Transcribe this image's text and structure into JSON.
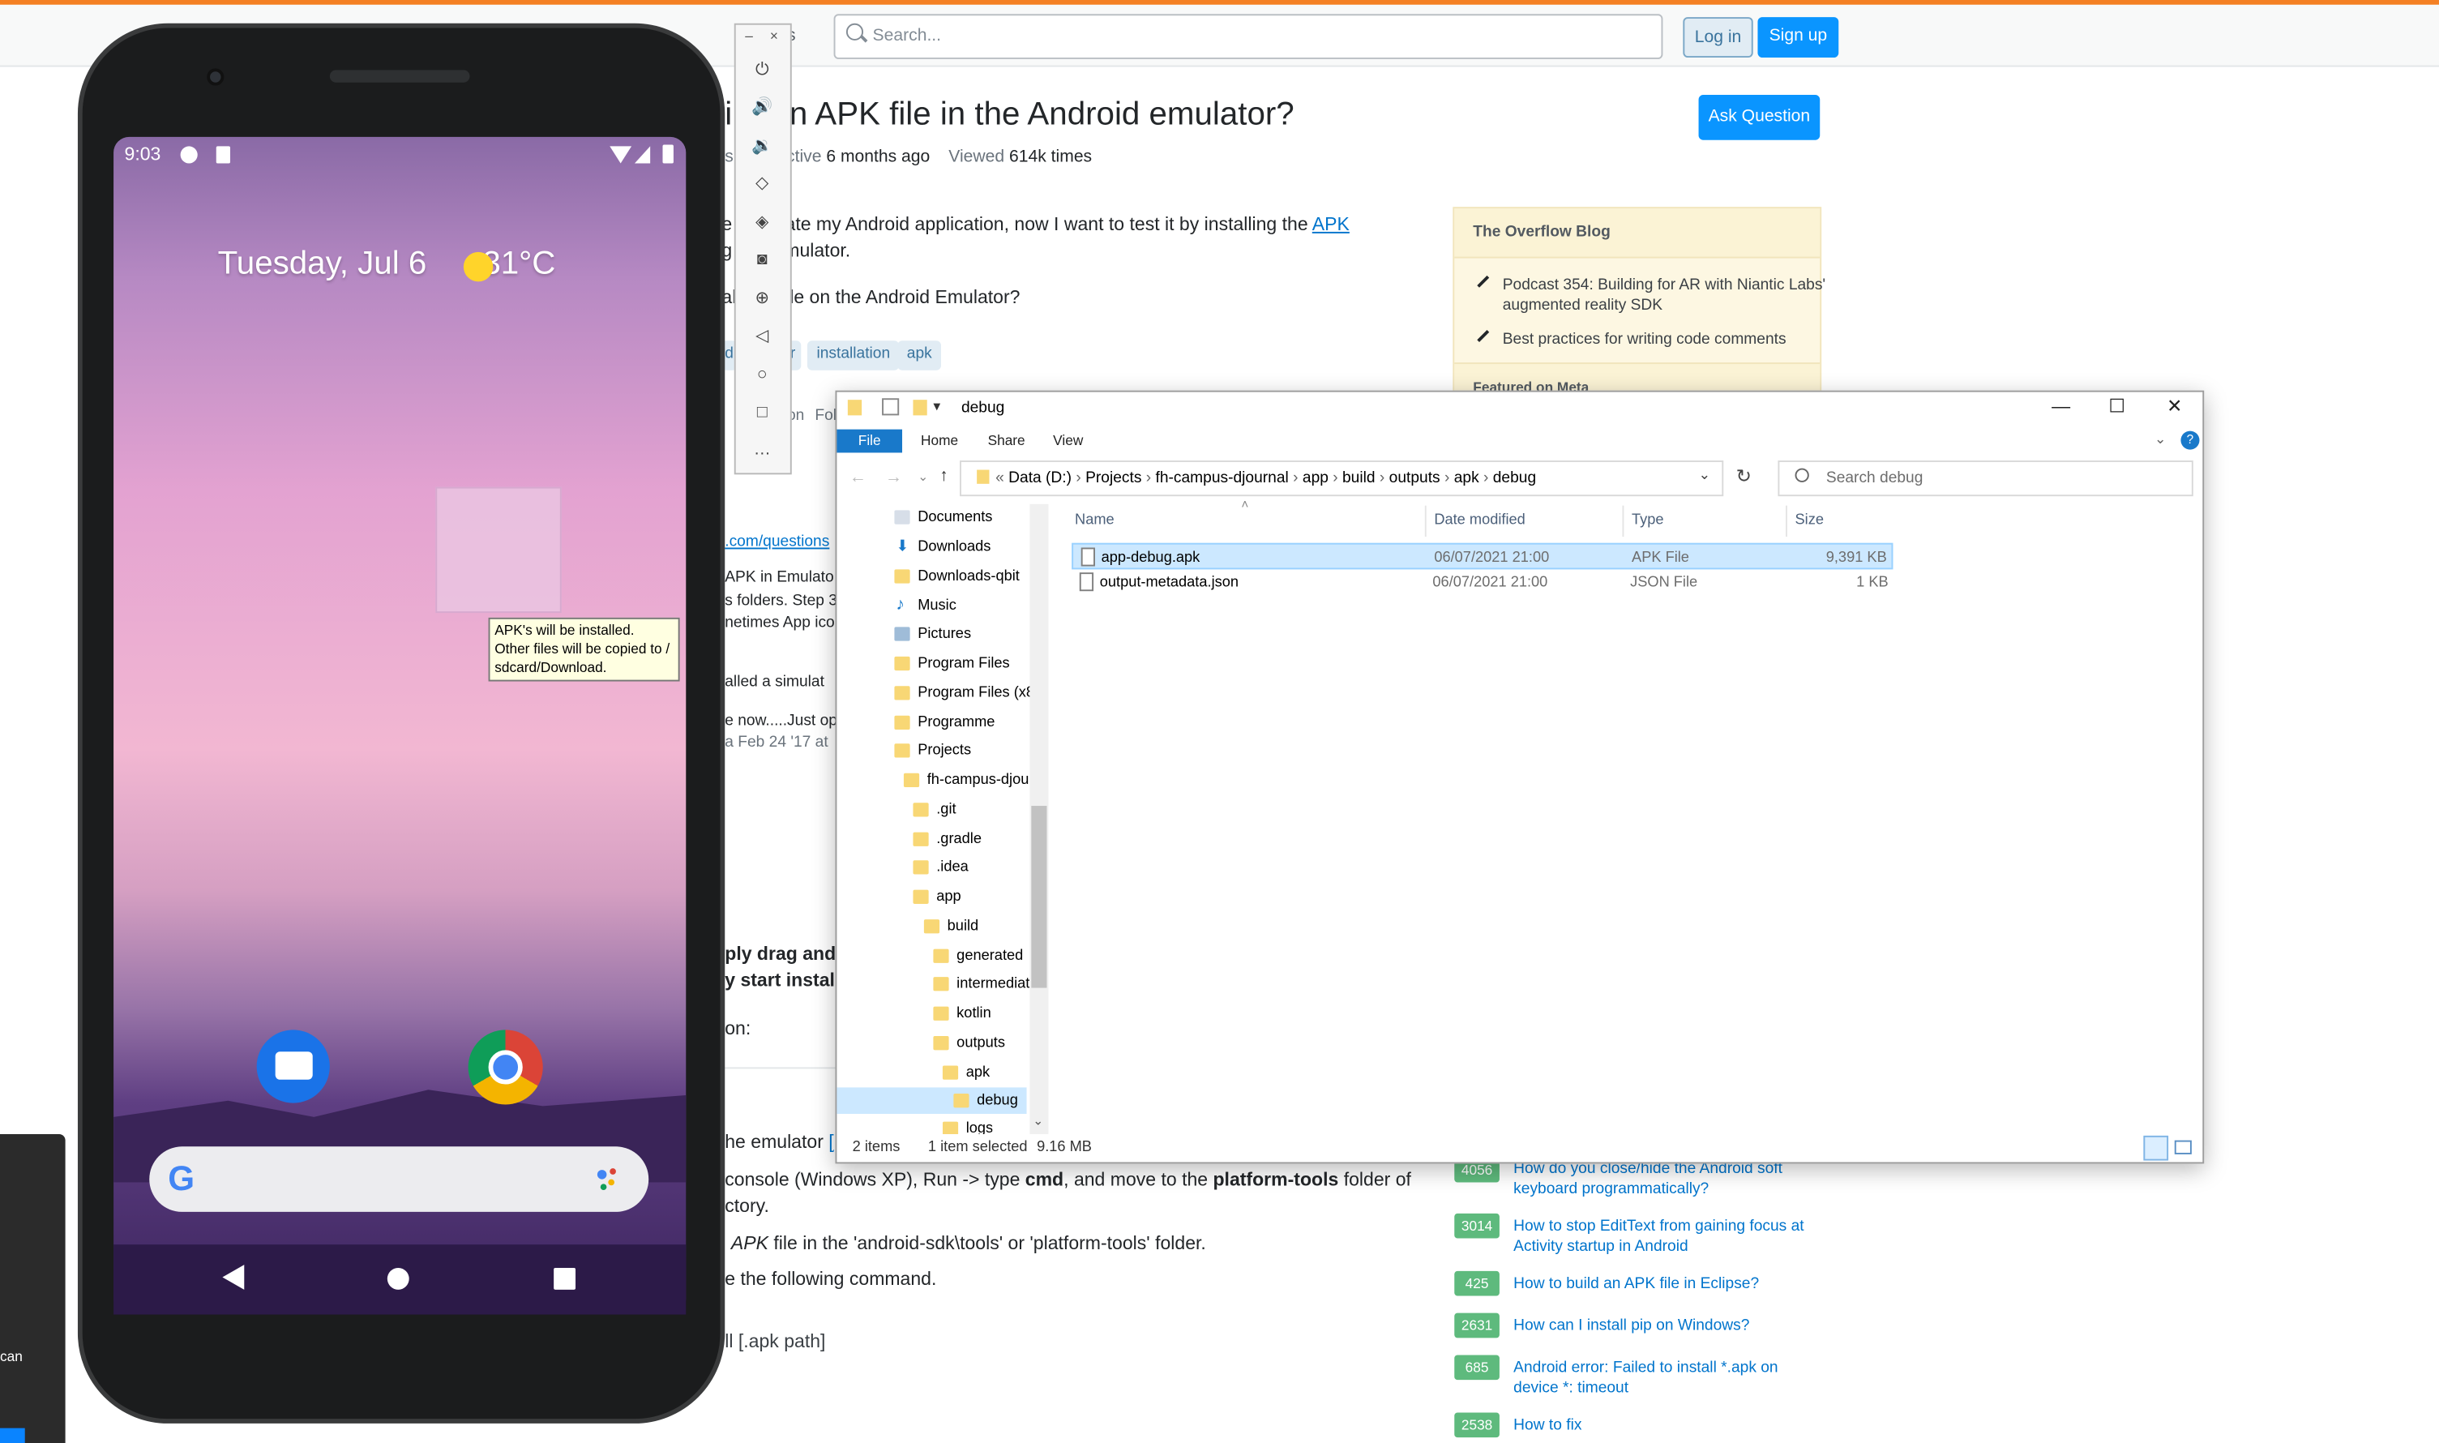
{
  "stackoverflow": {
    "search_placeholder": "Search...",
    "login": "Log in",
    "signup": "Sign up",
    "nav_fragment": "s",
    "title": "ll an APK file in the Android emulator?",
    "title_prefix": "i",
    "ask_question": "Ask Question",
    "meta_asked_fragment": "s",
    "meta_active_label": "ctive",
    "meta_active_value": "6 months ago",
    "meta_viewed_label": "Viewed",
    "meta_viewed_value": "614k times",
    "body_line1": "fuscate my Android application, now I want to test it by installing the ",
    "body_line1_prefix": "e",
    "body_link_apk": "APK",
    "body_line2_prefix": "g",
    "body_line2": "he emulator.",
    "body_line3_prefix": "al",
    "body_line3": "K file on the Android Emulator?",
    "tags": [
      "installation",
      "apk"
    ],
    "tag_fragments": [
      "d",
      "r"
    ],
    "follow_fragments": [
      "on",
      "Fol"
    ],
    "link_fragment": ".com/questions",
    "frag_lines": [
      "APK in Emulato",
      "s folders. Step 3",
      "netimes App ico",
      "alled a simulat",
      "e now.....Just op",
      "a Feb 24 '17 at"
    ],
    "bold_lines": [
      "ply drag and",
      "y start install"
    ],
    "on_line": "on:",
    "answer_emulator": "he emulator",
    "answer_emulator_link": "[",
    "answer_line2_a": "console (Windows XP), Run -> type ",
    "answer_line2_cmd": "cmd",
    "answer_line2_b": ", and move to the ",
    "answer_line2_pt": "platform-tools",
    "answer_line2_c": " folder of",
    "answer_line3": "ctory.",
    "answer_line4_apk": "APK",
    "answer_line4": " file in the 'android-sdk\\tools' or 'platform-tools' folder.",
    "answer_line5": "e the following command.",
    "answer_line6": "ll [.apk path]",
    "left_panel_text": "can"
  },
  "blog": {
    "title": "The Overflow Blog",
    "items": [
      "Podcast 354: Building for AR with Niantic Labs' augmented reality SDK",
      "Best practices for writing code comments"
    ],
    "featured_fragment": "Featured on Meta"
  },
  "related": [
    {
      "count": "4056",
      "text": "How do you close/hide the Android soft keyboard programmatically?"
    },
    {
      "count": "3014",
      "text": "How to stop EditText from gaining focus at Activity startup in Android"
    },
    {
      "count": "425",
      "text": "How to build an APK file in Eclipse?"
    },
    {
      "count": "2631",
      "text": "How can I install pip on Windows?"
    },
    {
      "count": "685",
      "text": "Android error: Failed to install *.apk on device *: timeout"
    },
    {
      "count": "2538",
      "text": "How to fix"
    }
  ],
  "phone": {
    "time": "9:03",
    "date": "Tuesday, Jul 6",
    "temperature": "31°C",
    "tooltip": [
      "APK's will be installed.",
      "Other files will be copied to /",
      "sdcard/Download."
    ]
  },
  "emulator_toolbar": [
    "power-icon",
    "volume-up-icon",
    "volume-down-icon",
    "rotate-left-icon",
    "rotate-right-icon",
    "camera-icon",
    "zoom-icon",
    "back-icon",
    "home-icon",
    "overview-icon",
    "more-icon"
  ],
  "explorer": {
    "title": "debug",
    "ribbon": {
      "file": "File",
      "home": "Home",
      "share": "Share",
      "view": "View"
    },
    "breadcrumb": [
      "Data (D:)",
      "Projects",
      "fh-campus-djournal",
      "app",
      "build",
      "outputs",
      "apk",
      "debug"
    ],
    "search_placeholder": "Search debug",
    "columns": {
      "name": "Name",
      "date": "Date modified",
      "type": "Type",
      "size": "Size"
    },
    "files": [
      {
        "name": "app-debug.apk",
        "date": "06/07/2021 21:00",
        "type": "APK File",
        "size": "9,391 KB"
      },
      {
        "name": "output-metadata.json",
        "date": "06/07/2021 21:00",
        "type": "JSON File",
        "size": "1 KB"
      }
    ],
    "nav": [
      "Documents",
      "Downloads",
      "Downloads-qbit",
      "Music",
      "Pictures",
      "Program Files",
      "Program Files (x8",
      "Programme",
      "Projects",
      "fh-campus-djou",
      ".git",
      ".gradle",
      ".idea",
      "app",
      "build",
      "generated",
      "intermediat",
      "kotlin",
      "outputs",
      "apk",
      "debug",
      "logs"
    ],
    "status_items": "2 items",
    "status_selected": "1 item selected",
    "status_size": "9.16 MB"
  }
}
